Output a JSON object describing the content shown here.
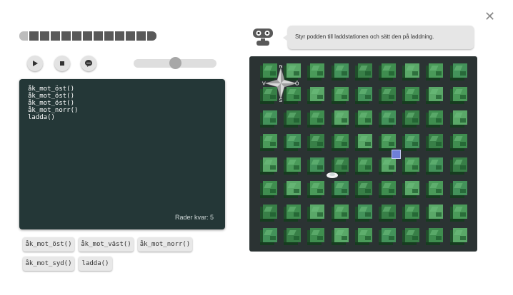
{
  "window": {
    "close_glyph": "✕"
  },
  "levels": {
    "count": 13,
    "current": 1
  },
  "controls": {
    "play": "play-icon",
    "stop": "stop-icon",
    "hint": "speech-bubble-icon",
    "speed_level": 0.5
  },
  "editor": {
    "lines": [
      "åk_mot_öst()",
      "åk_mot_öst()",
      "åk_mot_öst()",
      "åk_mot_norr()",
      "ladda()"
    ],
    "rows_left": "Rader kvar: 5"
  },
  "palette": {
    "commands": [
      "åk_mot_öst()",
      "åk_mot_väst()",
      "åk_mot_norr()",
      "åk_mot_syd()",
      "ladda()"
    ]
  },
  "instruction": "Styr podden till laddstationen och sätt den på laddning.",
  "compass": {
    "n": "N",
    "s": "S",
    "e": "Ö",
    "w": "V"
  },
  "board": {
    "cols": 9,
    "rows": 8
  },
  "colors": {
    "editor_bg": "#243737",
    "board_bg": "#2b3333",
    "tile": "#3f8d4f",
    "charger": "#6f7fd8"
  }
}
